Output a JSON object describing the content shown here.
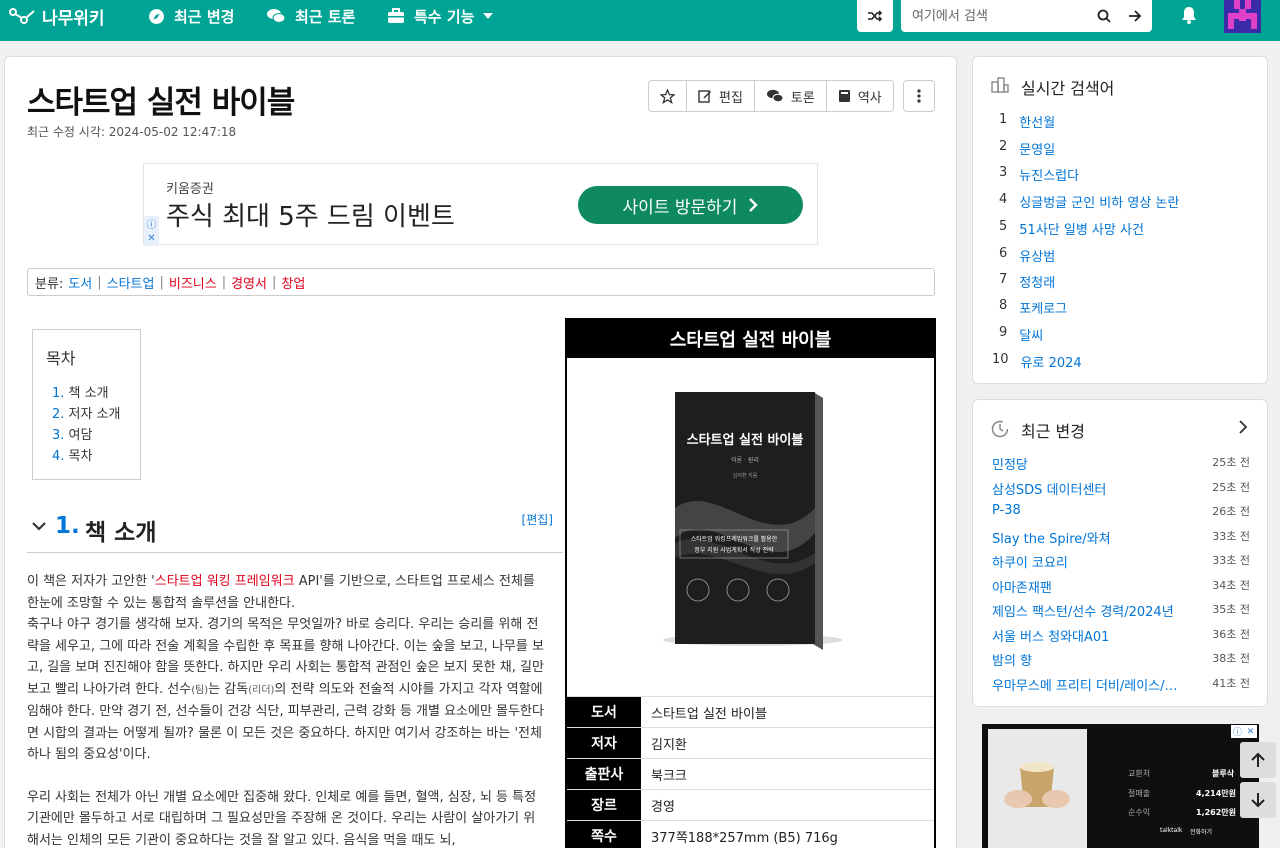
{
  "nav": {
    "logo": "나무위키",
    "recent_changes": "최근 변경",
    "recent_discuss": "최근 토론",
    "special": "특수 기능",
    "search_placeholder": "여기에서 검색"
  },
  "article": {
    "title": "스타트업 실전 바이블",
    "modified": "최근 수정 시각: 2024-05-02 12:47:18",
    "actions": [
      "편집",
      "토론",
      "역사"
    ]
  },
  "ad": {
    "advertiser": "키움증권",
    "headline": "주식 최대 5주 드림 이벤트",
    "cta": "사이트 방문하기"
  },
  "categories": {
    "label": "분류:",
    "items": [
      {
        "t": "도서",
        "c": "blue"
      },
      {
        "t": "스타트업",
        "c": "blue"
      },
      {
        "t": "비즈니스",
        "c": "red"
      },
      {
        "t": "경영서",
        "c": "red"
      },
      {
        "t": "창업",
        "c": "red"
      }
    ]
  },
  "toc": {
    "title": "목차",
    "items": [
      {
        "n": "1.",
        "t": "책 소개"
      },
      {
        "n": "2.",
        "t": "저자 소개"
      },
      {
        "n": "3.",
        "t": "여담"
      },
      {
        "n": "4.",
        "t": "목차"
      }
    ]
  },
  "section1": {
    "num": "1.",
    "title": "책 소개",
    "edit": "[편집]"
  },
  "body": {
    "p1a": "이 책은 저자가 고안한 '",
    "p1link": "스타트업 워킹 프레임워크",
    "p1b": " API'를 기반으로, 스타트업 프로세스 전체를 한눈에 조망할 수 있는 통합적 솔루션을 안내한다.",
    "p2a": "축구나 야구 경기를 생각해 보자. 경기의 목적은 무엇일까? 바로 승리다. 우리는 승리를 위해 전략을 세우고, 그에 따라 전술 계획을 수립한 후 목표를 향해 나아간다. 이는 숲을 보고, 나무를 보고, 길을 보며 진진해야 함을 뜻한다. 하지만 우리 사회는 통합적 관점인 숲은 보지 못한 채, 길만 보고 빨리 나아가려 한다. 선수",
    "p2s1": "(팀)",
    "p2b": "는 감독",
    "p2s2": "(리더)",
    "p2c": "의 전략 의도와 전술적 시야를 가지고 각자 역할에 임해야 한다. 만약 경기 전, 선수들이 건강 식단, 피부관리, 근력 강화 등 개별 요소에만 몰두한다면 시합의 결과는 어떻게 될까? 물론 이 모든 것은 중요하다. 하지만 여기서 강조하는 바는 '전체 하나 됨의 중요성'이다.",
    "p3": "우리 사회는 전체가 아닌 개별 요소에만 집중해 왔다. 인체로 예를 들면, 혈액, 심장, 뇌 등 특정 기관에만 몰두하고 서로 대립하며 그 필요성만을 주장해 온 것이다. 우리는 사람이 살아가기 위해서는 인체의 모든 기관이 중요하다는 것을 잘 알고 있다. 음식을 먹을 때도 뇌,"
  },
  "infobox": {
    "title": "스타트업 실전 바이블",
    "cover": {
      "title": "스타트업 실전 바이블",
      "sub": "이론 · 원리",
      "author": "김지환 지음",
      "line1": "스타트업 워킹프레임워크를 활용한",
      "line2": "정부 지원 사업계획서 작성 전략"
    },
    "rows": [
      {
        "k": "도서",
        "v": "스타트업 실전 바이블"
      },
      {
        "k": "저자",
        "v": "김지환"
      },
      {
        "k": "출판사",
        "v": "북크크"
      },
      {
        "k": "장르",
        "v": "경영"
      },
      {
        "k": "쪽수",
        "v": "377쪽188*257mm (B5) 716g"
      }
    ]
  },
  "trending": {
    "title": "실시간 검색어",
    "items": [
      "한선월",
      "문영일",
      "뉴진스럽다",
      "싱글벙글 군인 비하 영상 논란",
      "51사단 일병 사망 사건",
      "유상범",
      "정청래",
      "포케로그",
      "달씨",
      "유로 2024"
    ]
  },
  "recent": {
    "title": "최근 변경",
    "items": [
      {
        "t": "민정당",
        "m": "25초 전"
      },
      {
        "t": "삼성SDS 데이터센터",
        "m": "25초 전"
      },
      {
        "t": "P-38",
        "m": "26초 전"
      },
      {
        "t": "Slay the Spire/와쳐",
        "m": "33초 전"
      },
      {
        "t": "하쿠이 코요리",
        "m": "33초 전"
      },
      {
        "t": "아마존재팬",
        "m": "34초 전"
      },
      {
        "t": "제임스 팩스턴/선수 경력/2024년",
        "m": "35초 전"
      },
      {
        "t": "서울 버스 청와대A01",
        "m": "36초 전"
      },
      {
        "t": "밤의 향",
        "m": "38초 전"
      },
      {
        "t": "우마무스메 프리티 더비/레이스/…",
        "m": "41초 전"
      }
    ]
  },
  "side_ad": {
    "l1": "교환처",
    "v1": "블루삭",
    "l2": "절매출",
    "v2": "4,214만원",
    "l3": "순수익",
    "v3": "1,262만원",
    "brand": "talktalk",
    "tag": "전화하기"
  },
  "colors": {
    "brand": "#00a495",
    "link": "#0275d8",
    "redlink": "#e2001a"
  }
}
